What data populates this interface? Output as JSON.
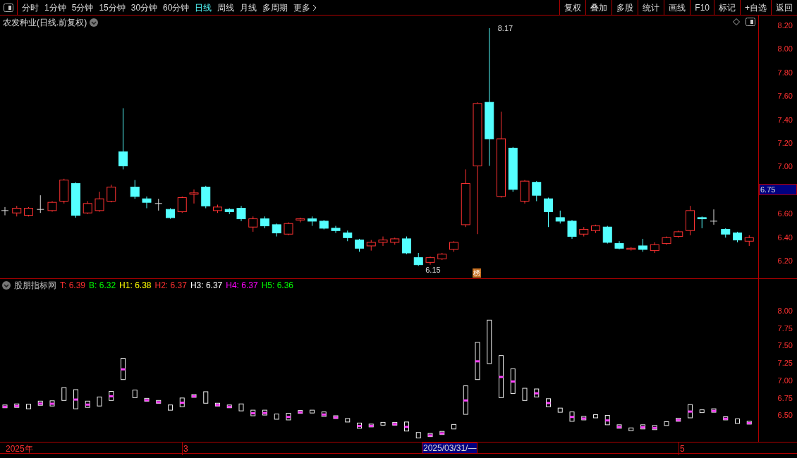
{
  "toolbar": {
    "periods": [
      {
        "label": "分时",
        "selected": false
      },
      {
        "label": "1分钟",
        "selected": false
      },
      {
        "label": "5分钟",
        "selected": false
      },
      {
        "label": "15分钟",
        "selected": false
      },
      {
        "label": "30分钟",
        "selected": false
      },
      {
        "label": "60分钟",
        "selected": false
      },
      {
        "label": "日线",
        "selected": true
      },
      {
        "label": "周线",
        "selected": false
      },
      {
        "label": "月线",
        "selected": false
      },
      {
        "label": "多周期",
        "selected": false
      }
    ],
    "more": "更多",
    "actions": [
      "复权",
      "叠加",
      "多股",
      "统计",
      "画线",
      "F10",
      "标记",
      "+自选",
      "返回"
    ]
  },
  "chart": {
    "title": "农发种业(日线.前复权)",
    "price_axis": [
      "8.20",
      "8.00",
      "7.80",
      "7.60",
      "7.40",
      "7.20",
      "7.00",
      "6.60",
      "6.40",
      "6.20"
    ],
    "current_price": "6.75",
    "high_label": "8.17",
    "low_label": "6.15",
    "badge": "榜"
  },
  "indicator": {
    "name": "股朋指标网",
    "values": [
      {
        "label": "T:",
        "value": "6.39",
        "color": "#ff3030"
      },
      {
        "label": "B:",
        "value": "6.32",
        "color": "#00ff00"
      },
      {
        "label": "H1:",
        "value": "6.38",
        "color": "#ffff00"
      },
      {
        "label": "H2:",
        "value": "6.37",
        "color": "#ff3030"
      },
      {
        "label": "H3:",
        "value": "6.37",
        "color": "#ffffff"
      },
      {
        "label": "H4:",
        "value": "6.37",
        "color": "#ff00ff"
      },
      {
        "label": "H5:",
        "value": "6.36",
        "color": "#00ff00"
      }
    ],
    "axis": [
      "8.00",
      "7.75",
      "7.50",
      "7.25",
      "7.00",
      "6.75",
      "6.50"
    ]
  },
  "time_axis": {
    "labels": [
      "2025年",
      "3",
      "5"
    ],
    "cursor_date": "2025/03/31/—"
  }
}
